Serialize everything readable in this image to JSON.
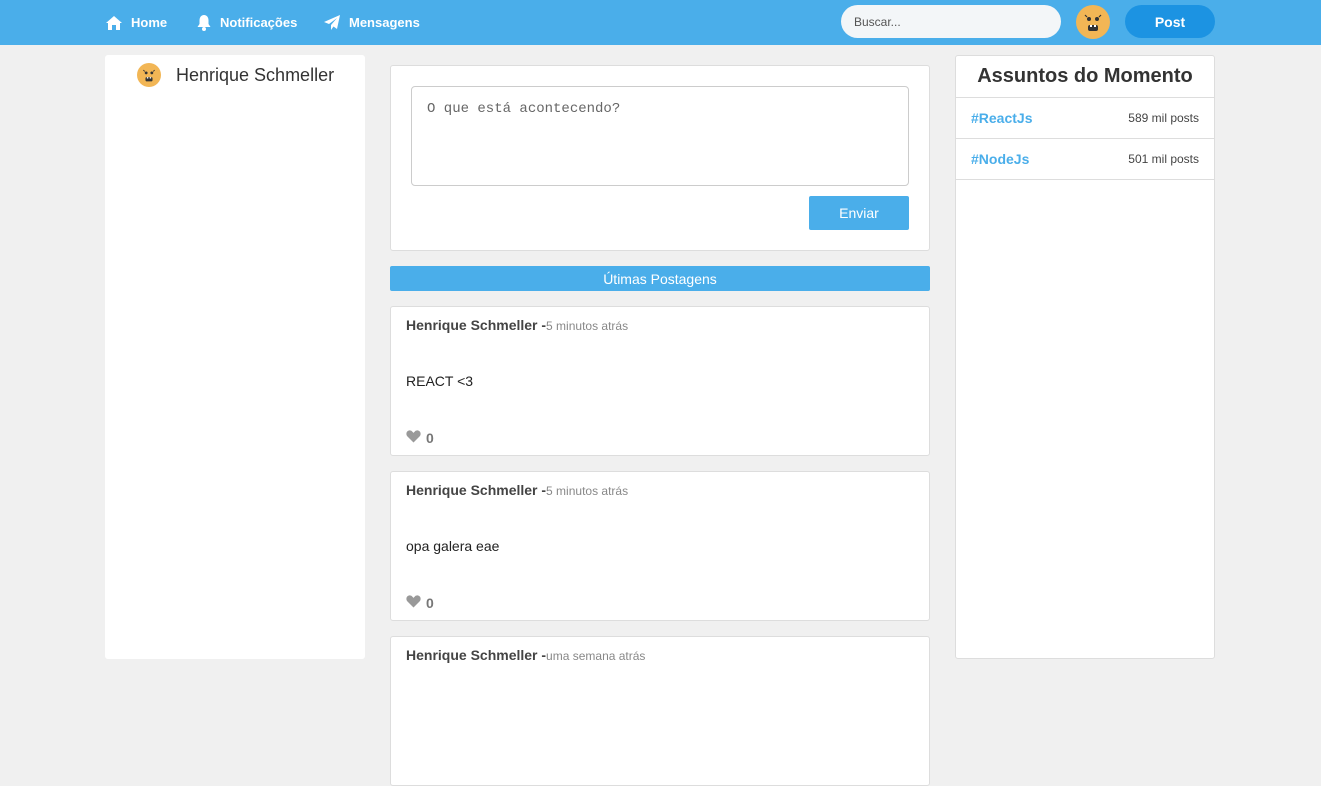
{
  "nav": {
    "home": "Home",
    "notifications": "Notificações",
    "messages": "Mensagens",
    "search_placeholder": "Buscar...",
    "post_button": "Post"
  },
  "profile": {
    "name": "Henrique Schmeller"
  },
  "composer": {
    "placeholder": "O que está acontecendo?",
    "send_label": "Enviar"
  },
  "feed": {
    "section_title": "Útimas Postagens"
  },
  "posts": [
    {
      "author": "Henrique Schmeller -",
      "time": "5 minutos atrás",
      "body": "REACT <3",
      "likes": "0"
    },
    {
      "author": "Henrique Schmeller -",
      "time": "5 minutos atrás",
      "body": "opa galera eae",
      "likes": "0"
    },
    {
      "author": "Henrique Schmeller -",
      "time": "uma semana atrás",
      "body": "",
      "likes": ""
    }
  ],
  "trends": {
    "title": "Assuntos do Momento",
    "items": [
      {
        "tag": "#ReactJs",
        "count": "589 mil posts"
      },
      {
        "tag": "#NodeJs",
        "count": "501 mil posts"
      }
    ]
  },
  "colors": {
    "accent": "#4aaeea",
    "post_button": "#1c93e2",
    "avatar": "#f2b655",
    "background": "#f0f0f0"
  },
  "icons": [
    "home-icon",
    "bell-icon",
    "paper-plane-icon",
    "heart-icon"
  ]
}
